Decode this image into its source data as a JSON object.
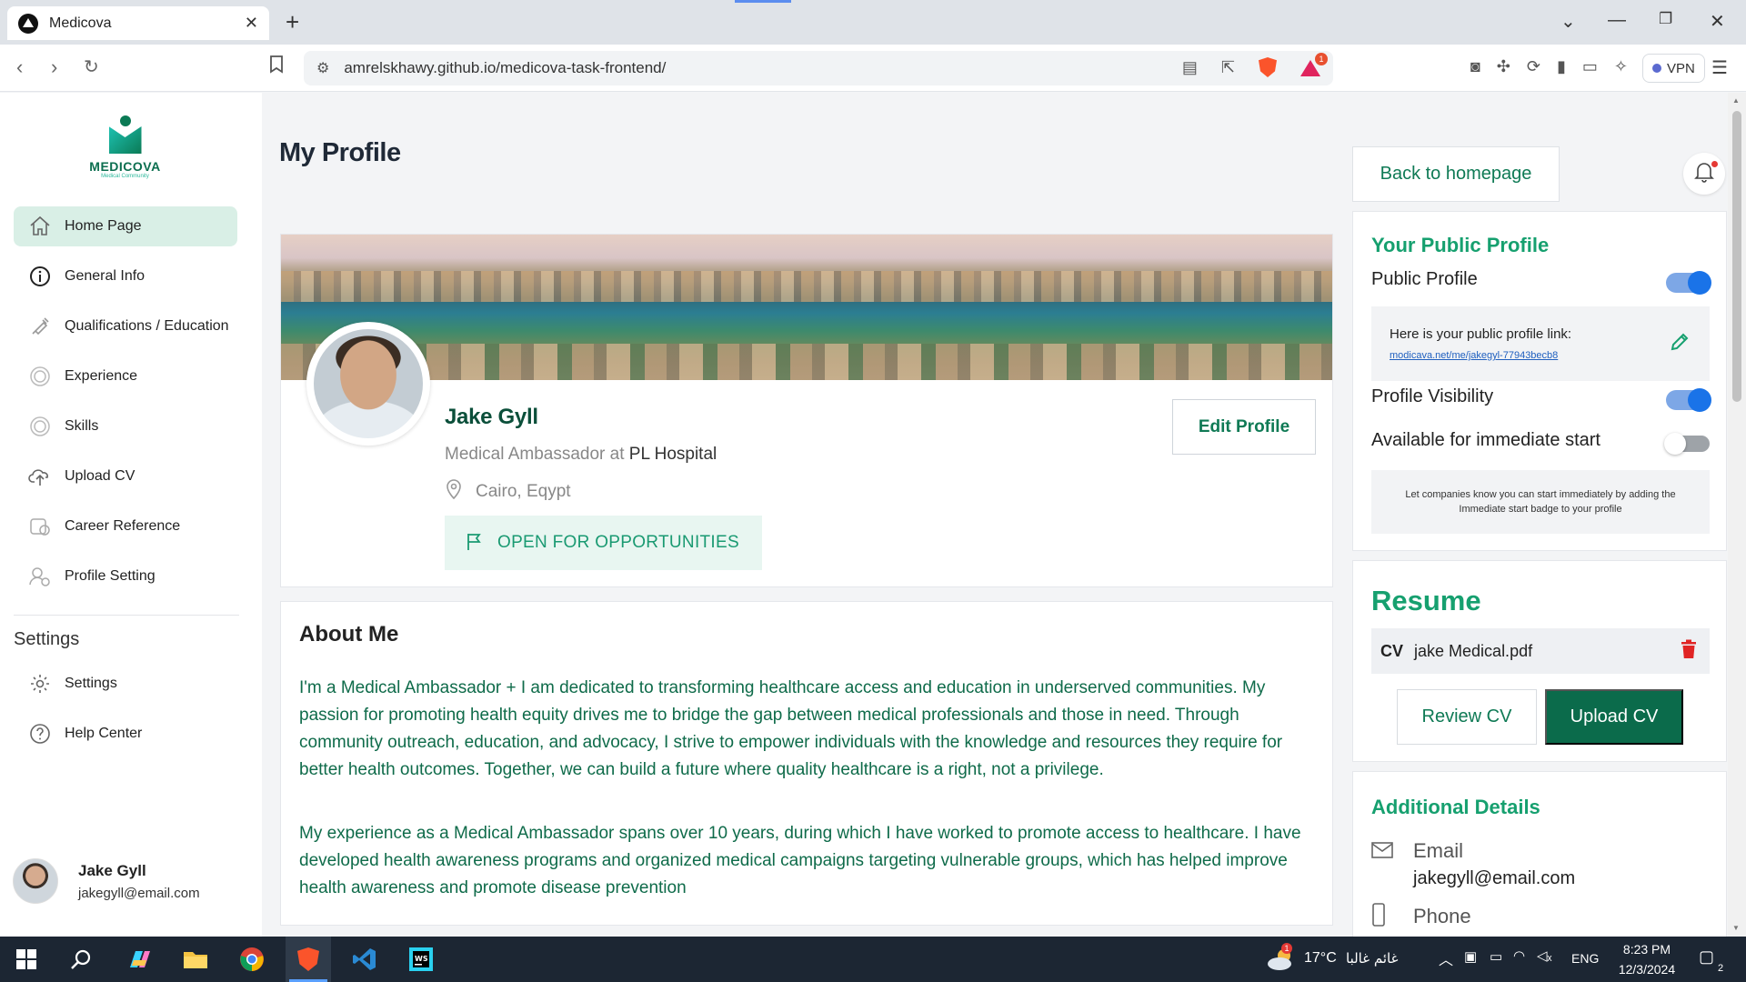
{
  "browser": {
    "tab_title": "Medicova",
    "url": "amrelskhawy.github.io/medicova-task-frontend/",
    "vpn_label": "VPN",
    "rewards_badge": "1",
    "icons": [
      "back-icon",
      "forward-icon",
      "reload-icon",
      "bookmark-icon",
      "site-info-icon",
      "reader-icon",
      "share-icon",
      "brave-shields-icon",
      "brave-rewards-icon",
      "screenshot-icon",
      "extensions-icon",
      "leo-icon",
      "sidebar-icon",
      "wallet-icon",
      "ai-icon",
      "menu-icon"
    ]
  },
  "sidebar": {
    "logo_text": "MEDICOVA",
    "logo_subtext": "Medical Community",
    "items": [
      {
        "label": "Home Page",
        "icon": "home-icon",
        "active": true
      },
      {
        "label": "General Info",
        "icon": "info-icon"
      },
      {
        "label": "Qualifications / Education",
        "icon": "syringe-icon"
      },
      {
        "label": "Experience",
        "icon": "badge-icon"
      },
      {
        "label": "Skills",
        "icon": "badge-icon"
      },
      {
        "label": "Upload CV",
        "icon": "cloud-upload-icon"
      },
      {
        "label": "Career Reference",
        "icon": "reference-icon"
      },
      {
        "label": "Profile Setting",
        "icon": "profile-setting-icon"
      }
    ],
    "settings_heading": "Settings",
    "settings_items": [
      {
        "label": "Settings",
        "icon": "gear-icon"
      },
      {
        "label": "Help Center",
        "icon": "help-icon"
      }
    ],
    "user": {
      "name": "Jake Gyll",
      "email": "jakegyll@email.com"
    }
  },
  "main": {
    "page_title": "My Profile",
    "profile": {
      "name": "Jake Gyll",
      "role": "Medical Ambassador at",
      "organization": "PL Hospital",
      "location": "Cairo, Eqypt",
      "status_badge": "OPEN FOR OPPORTUNITIES",
      "edit_button": "Edit Profile"
    },
    "about": {
      "title": "About Me",
      "paragraphs": [
        "I'm a Medical Ambassador + I am dedicated to transforming healthcare access and education in underserved communities. My passion for promoting health equity drives me to bridge the gap between medical professionals and those in need. Through community outreach, education, and advocacy, I strive to empower individuals with the knowledge and resources they require for better health outcomes. Together, we can build a future where quality healthcare is a right, not a privilege.",
        "My experience as a Medical Ambassador spans over 10 years, during which I have worked to promote access to healthcare. I have developed health awareness programs and organized medical campaigns targeting vulnerable groups, which has helped improve health awareness and promote disease prevention"
      ]
    }
  },
  "right_panel": {
    "back_button": "Back to homepage",
    "public_profile": {
      "title": "Your Public Profile",
      "public_profile_label": "Public Profile",
      "public_profile_on": true,
      "link_title": "Here is your public profile link:",
      "link_url": "modicava.net/me/jakegyl-77943becb8",
      "visibility_label": "Profile Visibility",
      "visibility_on": true,
      "immediate_label": "Available for immediate start",
      "immediate_on": false,
      "immediate_hint": "Let companies know you can start immediately by adding the Immediate start badge to your profile"
    },
    "resume": {
      "title": "Resume",
      "cv_tag": "CV",
      "cv_file": "jake Medical.pdf",
      "review_button": "Review CV",
      "upload_button": "Upload CV"
    },
    "additional": {
      "title": "Additional Details",
      "email_label": "Email",
      "email_value": "jakegyll@email.com",
      "phone_label": "Phone"
    }
  },
  "taskbar": {
    "weather_temp": "17°C",
    "weather_text": "غائم غالبا",
    "weather_badge": "1",
    "language": "ENG",
    "time": "8:23 PM",
    "date": "12/3/2024",
    "notification_count": "2"
  },
  "colors": {
    "brand_green": "#0b6b4b",
    "accent_green": "#16a06f",
    "active_bg": "#d9efe6",
    "toggle_blue": "#1a73e8",
    "delete_red": "#e02424"
  }
}
